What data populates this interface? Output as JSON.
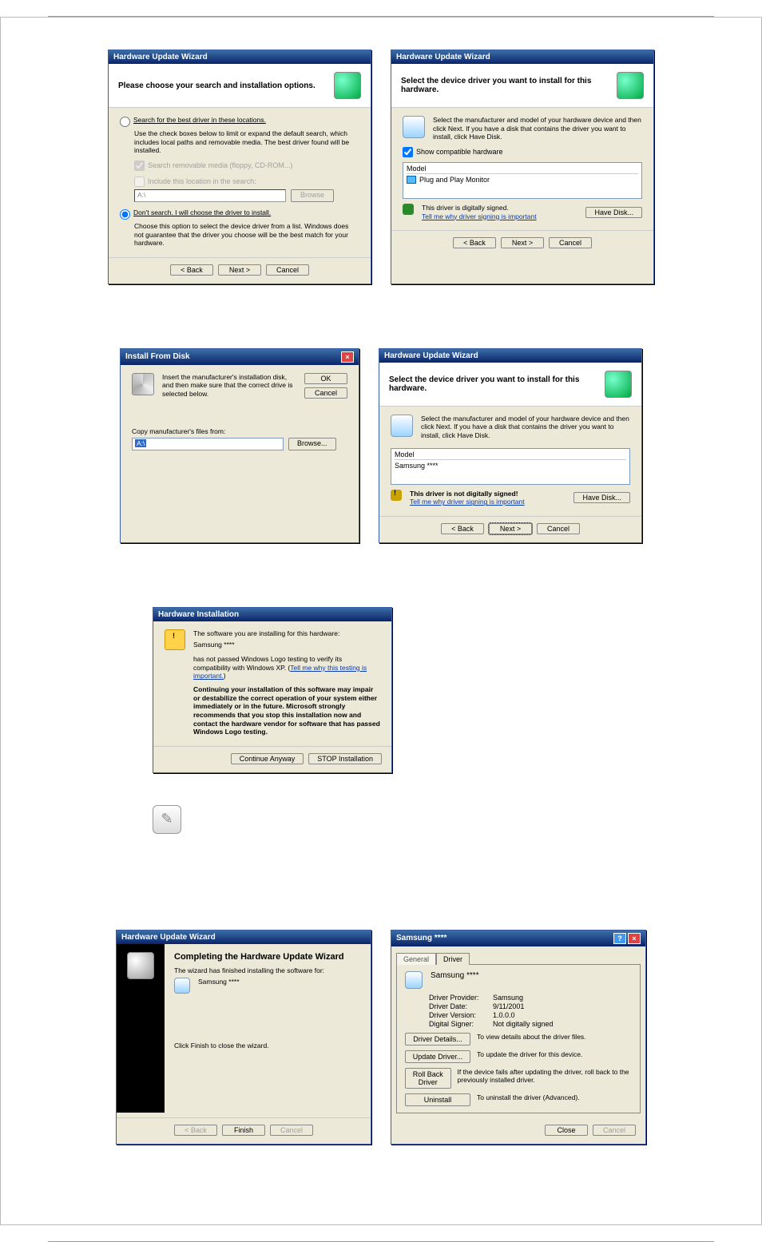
{
  "wiz1": {
    "title": "Hardware Update Wizard",
    "heading": "Please choose your search and installation options.",
    "opt_search": "Search for the best driver in these locations.",
    "opt_search_help": "Use the check boxes below to limit or expand the default search, which includes local paths and removable media. The best driver found will be installed.",
    "chk_removable": "Search removable media (floppy, CD-ROM...)",
    "chk_include": "Include this location in the search:",
    "path": "A:\\",
    "browse": "Browse",
    "opt_dont": "Don't search. I will choose the driver to install.",
    "opt_dont_help": "Choose this option to select the device driver from a list. Windows does not guarantee that the driver you choose will be the best match for your hardware.",
    "back": "< Back",
    "next": "Next >",
    "cancel": "Cancel"
  },
  "wiz2": {
    "title": "Hardware Update Wizard",
    "heading": "Select the device driver you want to install for this hardware.",
    "help": "Select the manufacturer and model of your hardware device and then click Next. If you have a disk that contains the driver you want to install, click Have Disk.",
    "chk_compat": "Show compatible hardware",
    "col_model": "Model",
    "model_item": "Plug and Play Monitor",
    "signed": "This driver is digitally signed.",
    "tell_me": "Tell me why driver signing is important",
    "have_disk": "Have Disk...",
    "back": "< Back",
    "next": "Next >",
    "cancel": "Cancel"
  },
  "ifd": {
    "title": "Install From Disk",
    "help": "Insert the manufacturer's installation disk, and then make sure that the correct drive is selected below.",
    "ok": "OK",
    "cancel": "Cancel",
    "copy_label": "Copy manufacturer's files from:",
    "path": "A:\\",
    "browse": "Browse..."
  },
  "wiz3": {
    "title": "Hardware Update Wizard",
    "heading": "Select the device driver you want to install for this hardware.",
    "help": "Select the manufacturer and model of your hardware device and then click Next. If you have a disk that contains the driver you want to install, click Have Disk.",
    "col_model": "Model",
    "model_item": "Samsung ****",
    "not_signed": "This driver is not digitally signed!",
    "tell_me": "Tell me why driver signing is important",
    "have_disk": "Have Disk...",
    "back": "< Back",
    "next": "Next >",
    "cancel": "Cancel"
  },
  "hwinst": {
    "title": "Hardware Installation",
    "l1": "The software you are installing for this hardware:",
    "l2": "Samsung ****",
    "l3a": "has not passed Windows Logo testing to verify its compatibility with Windows XP. (",
    "l3link": "Tell me why this testing is important.",
    "l3b": ")",
    "l4": "Continuing your installation of this software may impair or destabilize the correct operation of your system either immediately or in the future. Microsoft strongly recommends that you stop this installation now and contact the hardware vendor for software that has passed Windows Logo testing.",
    "cont": "Continue Anyway",
    "stop": "STOP Installation"
  },
  "wiz4": {
    "title": "Hardware Update Wizard",
    "heading": "Completing the Hardware Update Wizard",
    "l1": "The wizard has finished installing the software for:",
    "l2": "Samsung ****",
    "l3": "Click Finish to close the wizard.",
    "back": "< Back",
    "finish": "Finish",
    "cancel": "Cancel"
  },
  "props": {
    "title": "Samsung ****",
    "tab_general": "General",
    "tab_driver": "Driver",
    "device": "Samsung ****",
    "provider_k": "Driver Provider:",
    "provider_v": "Samsung",
    "date_k": "Driver Date:",
    "date_v": "9/11/2001",
    "ver_k": "Driver Version:",
    "ver_v": "1.0.0.0",
    "signer_k": "Digital Signer:",
    "signer_v": "Not digitally signed",
    "details_btn": "Driver Details...",
    "details_txt": "To view details about the driver files.",
    "update_btn": "Update Driver...",
    "update_txt": "To update the driver for this device.",
    "rollback_btn": "Roll Back Driver",
    "rollback_txt": "If the device fails after updating the driver, roll back to the previously installed driver.",
    "uninstall_btn": "Uninstall",
    "uninstall_txt": "To uninstall the driver (Advanced).",
    "close": "Close",
    "cancel": "Cancel"
  }
}
